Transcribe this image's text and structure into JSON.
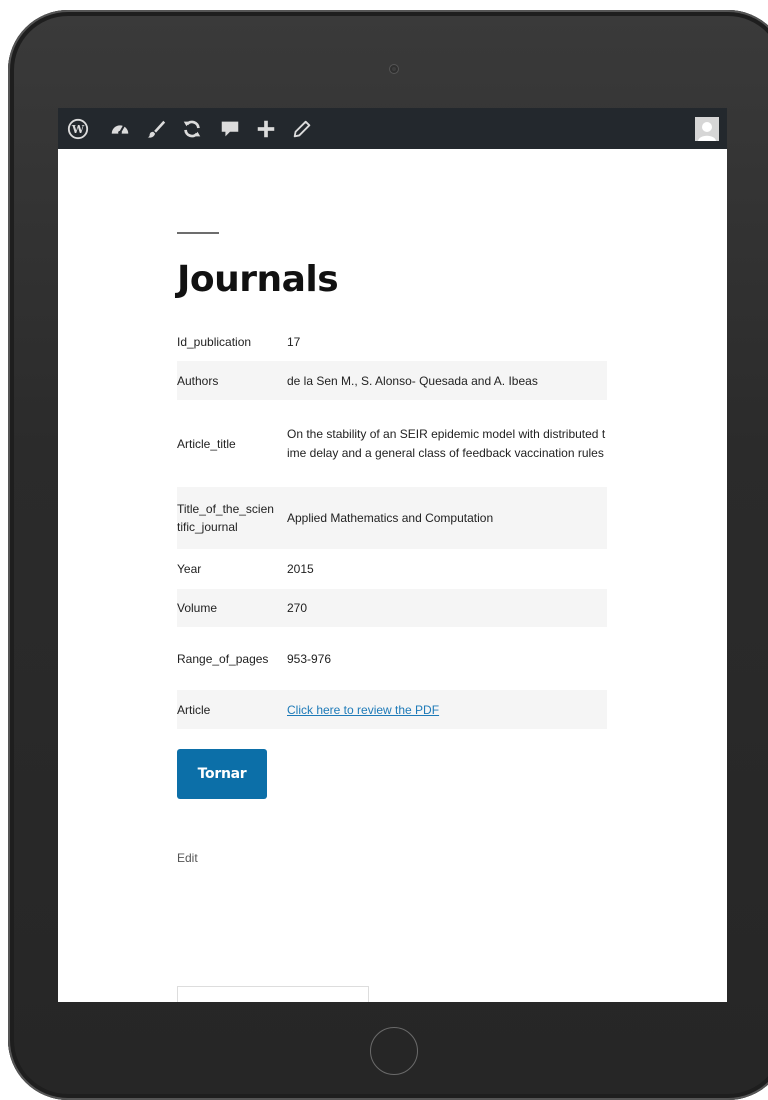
{
  "adminbar": {
    "icons": [
      "wordpress-icon",
      "dashboard-icon",
      "customize-brush-icon",
      "updates-icon",
      "comments-icon",
      "new-content-plus-icon",
      "edit-pencil-icon"
    ],
    "avatar": "user-avatar"
  },
  "page": {
    "title": "Journals",
    "fields": [
      {
        "key": "Id_publication",
        "value": "17"
      },
      {
        "key": "Authors",
        "value": "de la Sen M., S. Alonso- Quesada and A. Ibeas"
      },
      {
        "key": "Article_title",
        "value": "On the stability of an SEIR epidemic model with distributed time delay and a general class of feedback vaccination rules"
      },
      {
        "key": "Title_of_the_scientific_journal",
        "value": "Applied Mathematics and Computation"
      },
      {
        "key": "Year",
        "value": "2015"
      },
      {
        "key": "Volume",
        "value": "270"
      },
      {
        "key": "Range_of_pages",
        "value": "953-976"
      },
      {
        "key": "Article",
        "value": "Click here to review the PDF"
      }
    ],
    "back_button": "Tornar",
    "edit_link": "Edit"
  },
  "colors": {
    "adminbar_bg": "#23282d",
    "button_bg": "#0c6fa8",
    "link": "#1d7ab8",
    "row_alt": "#f5f5f5"
  }
}
